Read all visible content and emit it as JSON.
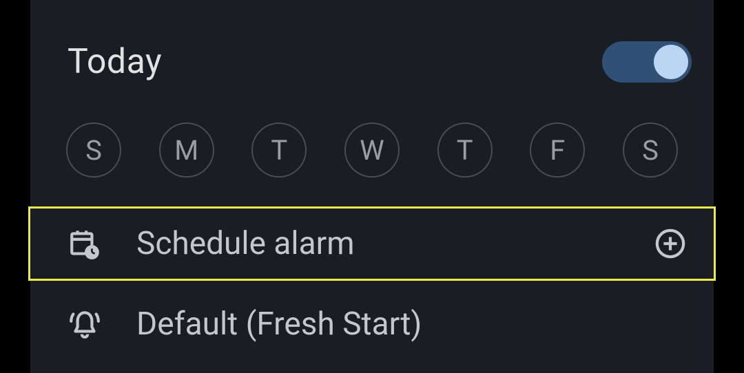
{
  "header": {
    "label": "Today",
    "toggle_on": true
  },
  "days": [
    {
      "label": "S"
    },
    {
      "label": "M"
    },
    {
      "label": "T"
    },
    {
      "label": "W"
    },
    {
      "label": "T"
    },
    {
      "label": "F"
    },
    {
      "label": "S"
    }
  ],
  "options": {
    "schedule": {
      "label": "Schedule alarm"
    },
    "sound": {
      "label": "Default (Fresh Start)"
    }
  }
}
